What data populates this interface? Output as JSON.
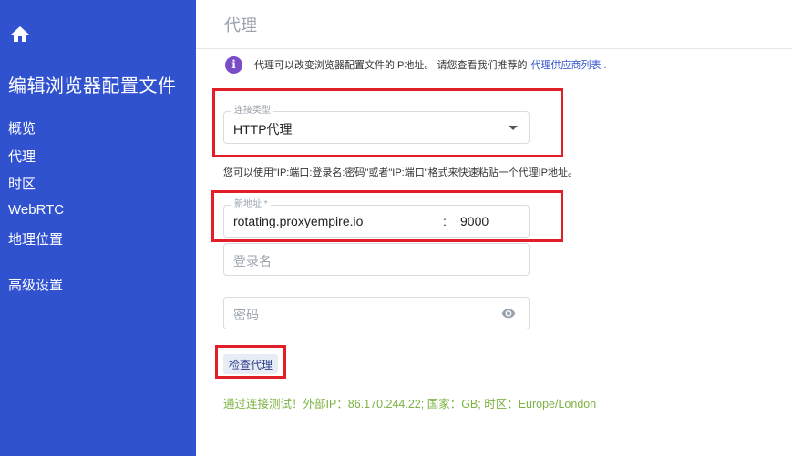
{
  "sidebar": {
    "title": "编辑浏览器配置文件",
    "items": [
      {
        "label": "概览"
      },
      {
        "label": "代理"
      },
      {
        "label": "时区"
      },
      {
        "label": "WebRTC"
      },
      {
        "label": "地理位置"
      },
      {
        "label": "高级设置"
      }
    ],
    "background_color": "#3152cf"
  },
  "header": {
    "title": "代理"
  },
  "info": {
    "text": "代理可以改变浏览器配置文件的IP地址。 请您查看我们推荐的",
    "link_label": "代理供应商列表 ."
  },
  "connection_type": {
    "label": "连接类型",
    "value": "HTTP代理"
  },
  "hint": "您可以使用\"IP:端口:登录名:密码\"或者\"IP:端口\"格式来快速粘贴一个代理IP地址。",
  "address": {
    "label": "新地址 *",
    "host": "rotating.proxyempire.io",
    "separator": ":",
    "port": "9000"
  },
  "login": {
    "placeholder": "登录名"
  },
  "password": {
    "placeholder": "密码"
  },
  "check_button": {
    "label": "检查代理"
  },
  "result": {
    "text": "通过连接测试！外部IP：86.170.244.22; 国家：GB; 时区：Europe/London",
    "color": "#7cb342"
  },
  "annotation_color": "#e21f26"
}
